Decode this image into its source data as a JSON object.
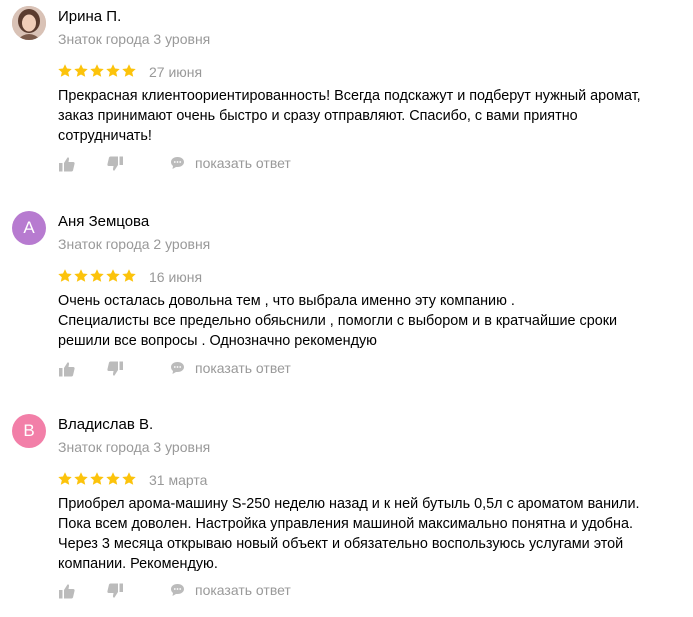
{
  "colors": {
    "star": "#fcc30b",
    "muted": "#999999",
    "icon": "#bbbbbb",
    "avatar_a": "#b77bd0",
    "avatar_b": "#f27fa8"
  },
  "reviews": [
    {
      "avatar_letter": "",
      "author": "Ирина П.",
      "level": "Знаток города 3 уровня",
      "rating": 5,
      "date": "27 июня",
      "text_lines": [
        "Прекрасная клиентоориентированность! Всегда подскажут и подберут нужный аромат,",
        "заказ принимают очень быстро и сразу отправляют. Спасибо, с вами приятно",
        "сотрудничать!"
      ],
      "reply_label": "показать ответ"
    },
    {
      "avatar_letter": "А",
      "author": "Аня Земцова",
      "level": "Знаток города 2 уровня",
      "rating": 5,
      "date": "16 июня",
      "text_lines": [
        "Очень осталась довольна тем , что выбрала именно эту компанию .",
        "Специалисты все предельно обяьснили , помогли с выбором и в кратчайшие сроки",
        "решили все вопросы . Однозначно рекомендую"
      ],
      "reply_label": "показать ответ"
    },
    {
      "avatar_letter": "В",
      "author": "Владислав В.",
      "level": "Знаток города 3 уровня",
      "rating": 5,
      "date": "31 марта",
      "text_lines": [
        "Приобрел арома-машину S-250 неделю назад и к ней бутыль 0,5л с ароматом ванили.",
        "Пока всем доволен. Настройка управления машиной максимально понятна и удобна.",
        "Через 3 месяца открываю новый объект и обязательно воспользуюсь услугами этой",
        "компании. Рекомендую."
      ],
      "reply_label": "показать ответ"
    }
  ]
}
